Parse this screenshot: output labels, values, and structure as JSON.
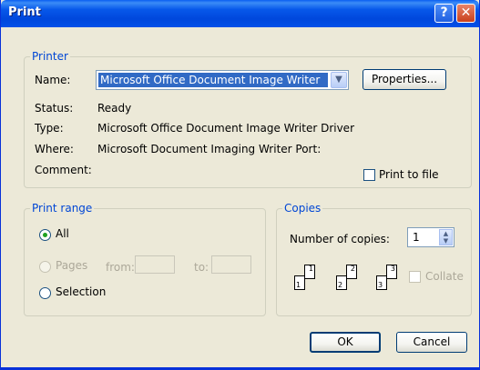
{
  "window": {
    "title": "Print",
    "help_label": "?",
    "close_label": "✕"
  },
  "printer": {
    "group_label": "Printer",
    "name_label": "Name:",
    "name_value": "Microsoft Office Document Image Writer",
    "properties_label": "Properties...",
    "status_label": "Status:",
    "status_value": "Ready",
    "type_label": "Type:",
    "type_value": "Microsoft Office Document Image Writer Driver",
    "where_label": "Where:",
    "where_value": "Microsoft Document Imaging Writer Port:",
    "comment_label": "Comment:",
    "comment_value": "",
    "print_to_file_label": "Print to file",
    "print_to_file_checked": false
  },
  "print_range": {
    "group_label": "Print range",
    "all_label": "All",
    "pages_label": "Pages",
    "from_label": "from:",
    "to_label": "to:",
    "from_value": "",
    "to_value": "",
    "selection_label": "Selection",
    "selected": "All"
  },
  "copies": {
    "group_label": "Copies",
    "number_label": "Number of copies:",
    "number_value": "1",
    "collate_label": "Collate",
    "collate_checked": false,
    "collate_icon_pages": [
      "1",
      "1",
      "2",
      "2",
      "3",
      "3"
    ]
  },
  "buttons": {
    "ok_label": "OK",
    "cancel_label": "Cancel"
  },
  "colors": {
    "titlebar": "#0054e3",
    "group_label": "#0046d5",
    "selection": "#316ac5",
    "dialog_bg": "#ece9d8"
  }
}
